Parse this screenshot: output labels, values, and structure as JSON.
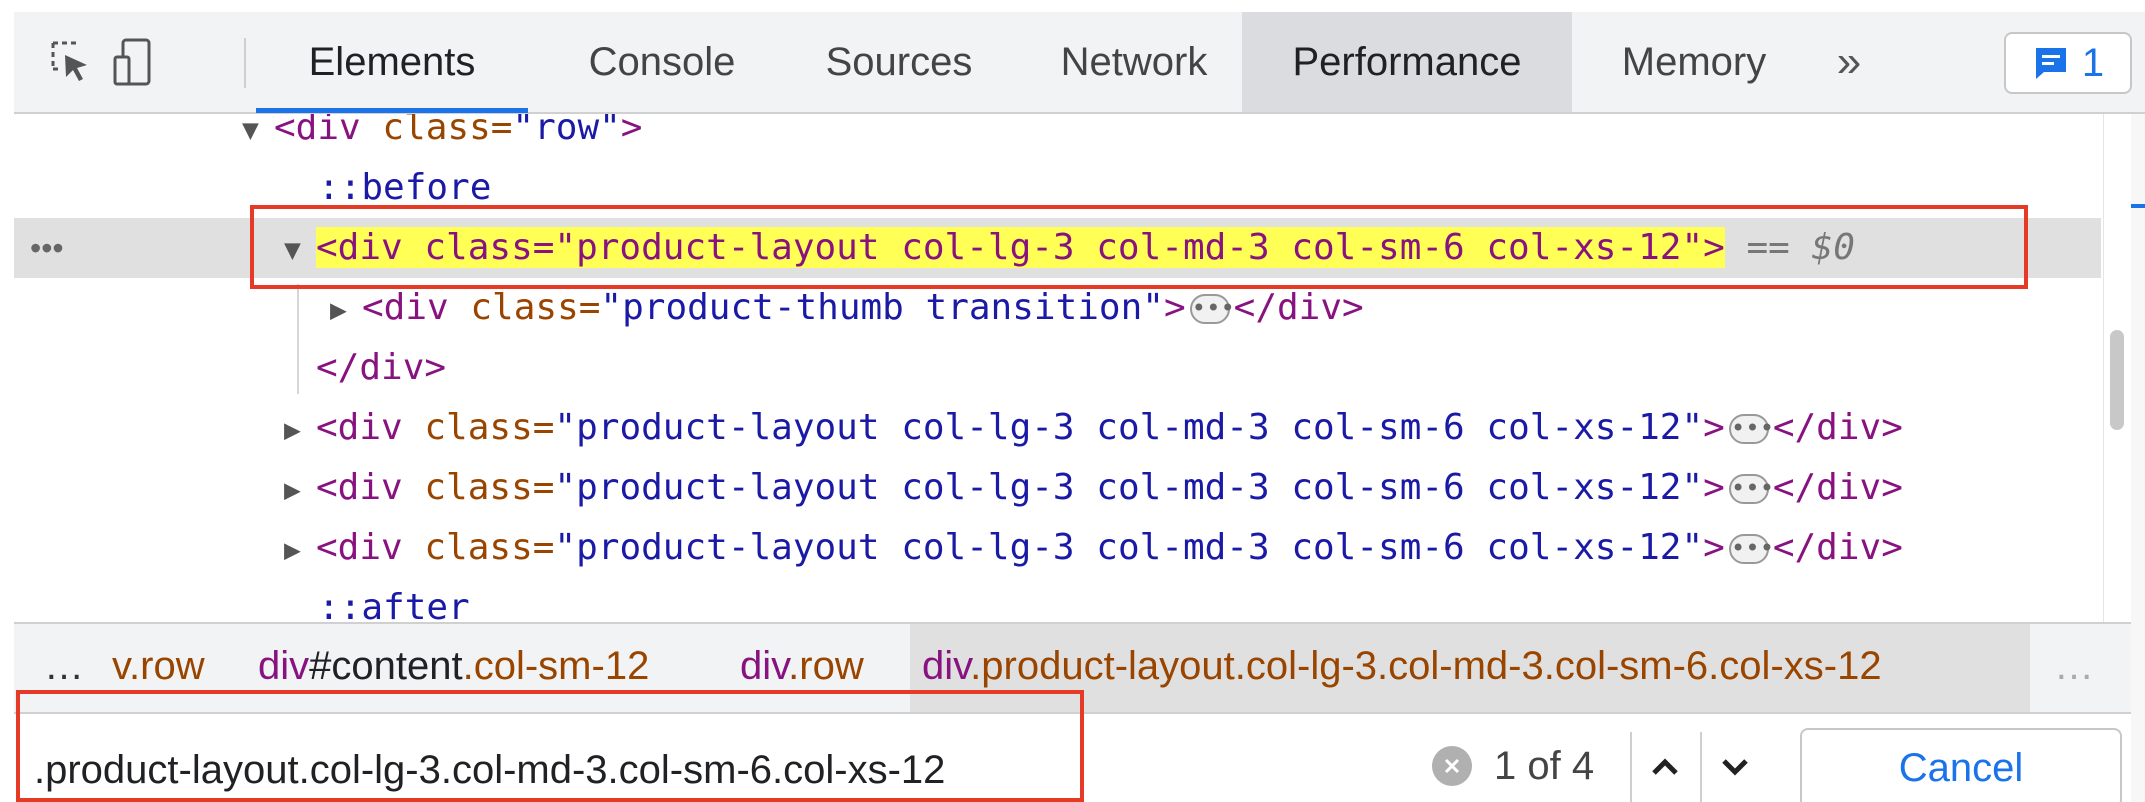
{
  "toolbar": {
    "tabs": [
      "Elements",
      "Console",
      "Sources",
      "Network",
      "Performance",
      "Memory"
    ],
    "more_label": "»",
    "issues_count": "1"
  },
  "tree": {
    "row_line": {
      "tag_open": "<div",
      "attr": " class=",
      "val": "\"row\"",
      "close": ">"
    },
    "before": "::before",
    "selected": {
      "text": "<div class=\"product-layout col-lg-3 col-md-3 col-sm-6 col-xs-12\">",
      "ref": "== $0"
    },
    "child": {
      "tag_open": "<div",
      "attr": " class=",
      "val": "\"product-thumb transition\"",
      "close": ">",
      "end": "</div>"
    },
    "close_div": "</div>",
    "sibling": {
      "tag_open": "<div",
      "attr": " class=",
      "val": "\"product-layout col-lg-3 col-md-3 col-sm-6 col-xs-12\"",
      "close": ">",
      "end": "</div>"
    },
    "after": "::after",
    "gutter_dots": "•••"
  },
  "breadcrumbs": {
    "left_more": "…",
    "items": [
      {
        "tag": "",
        "id": "",
        "cls": "v.row"
      },
      {
        "tag": "div",
        "id": "#content",
        "cls": ".col-sm-12"
      },
      {
        "tag": "div",
        "id": "",
        "cls": ".row"
      },
      {
        "tag": "div",
        "id": "",
        "cls": ".product-layout.col-lg-3.col-md-3.col-sm-6.col-xs-12"
      }
    ],
    "right_more": "…"
  },
  "search": {
    "value": ".product-layout.col-lg-3.col-md-3.col-sm-6.col-xs-12",
    "match_count": "1 of 4",
    "cancel_label": "Cancel"
  },
  "colors": {
    "accent": "#1a73e8",
    "highlight": "#ffff55",
    "annotation_red": "#e53a25",
    "tag": "#881280",
    "attr": "#994500",
    "value": "#1a1aa6"
  }
}
